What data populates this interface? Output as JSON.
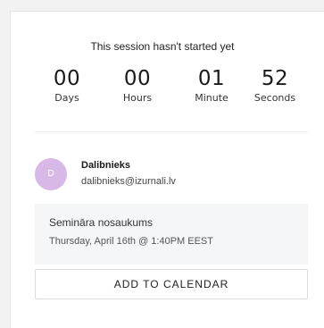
{
  "status_text": "This session hasn't started yet",
  "countdown": [
    {
      "value": "00",
      "label": "Days"
    },
    {
      "value": "00",
      "label": "Hours"
    },
    {
      "value": "01",
      "label": "Minute"
    },
    {
      "value": "52",
      "label": "Seconds"
    }
  ],
  "host": {
    "avatar_initial": "D",
    "name": "Dalibnieks",
    "email": "dalibnieks@izurnali.lv"
  },
  "session": {
    "title": "Semināra nosaukums",
    "time": "Thursday, April 16th @ 1:40PM EEST"
  },
  "calendar_button_label": "ADD TO CALENDAR",
  "colors": {
    "avatar_bg": "#d8b8e6",
    "session_bg": "#f4f6f8"
  }
}
